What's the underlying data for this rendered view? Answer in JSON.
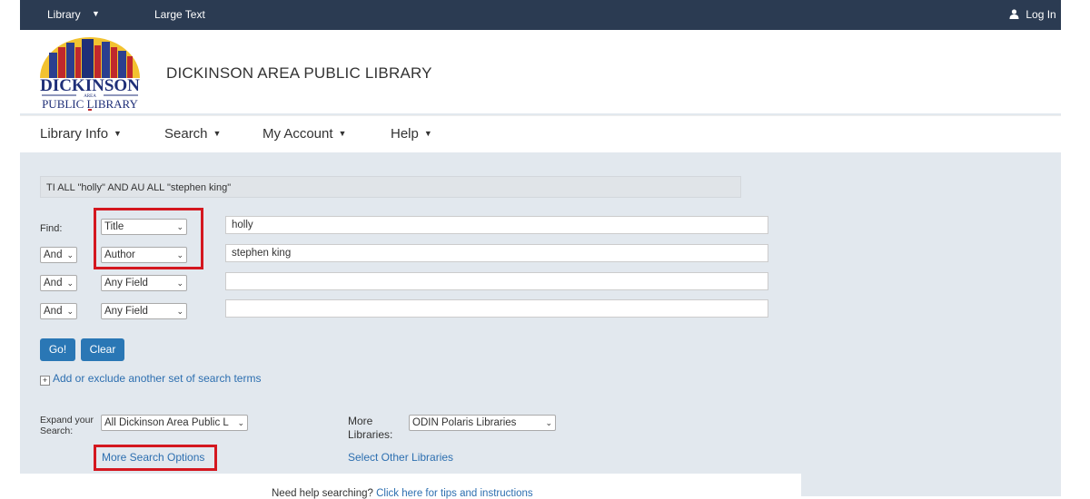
{
  "topbar": {
    "library_menu": "Library",
    "large_text": "Large Text",
    "login": "Log In"
  },
  "header": {
    "logo_text_top": "DICKINSON",
    "logo_text_mid": "AREA",
    "logo_text_bottom": "PUBLIC LIBRARY",
    "library_name": "DICKINSON AREA PUBLIC LIBRARY"
  },
  "nav": {
    "items": [
      "Library Info",
      "Search",
      "My Account",
      "Help"
    ]
  },
  "search": {
    "query_summary": "TI ALL \"holly\" AND AU ALL \"stephen king\"",
    "find_label": "Find:",
    "rows": [
      {
        "field": "Title",
        "value": "holly"
      },
      {
        "operator": "And",
        "field": "Author",
        "value": "stephen king"
      },
      {
        "operator": "And",
        "field": "Any Field",
        "value": ""
      },
      {
        "operator": "And",
        "field": "Any Field",
        "value": ""
      }
    ],
    "go_label": "Go!",
    "clear_label": "Clear",
    "add_terms_link": "Add or exclude another set of search terms",
    "expand_label_line1": "Expand your",
    "expand_label_line2": "Search:",
    "expand_value": "All Dickinson Area Public L",
    "more_libraries_line1": "More",
    "more_libraries_line2": "Libraries:",
    "more_libraries_value": "ODIN Polaris Libraries",
    "more_search_options": "More Search Options",
    "select_other_libraries": "Select Other Libraries",
    "help_prefix": "Need help searching?",
    "help_link": "Click here for tips and instructions"
  },
  "colors": {
    "topbar": "#2b3b52",
    "page_bg": "#e2e8ee",
    "button": "#2a77b5",
    "link": "#2d6fb0",
    "highlight": "#d4171f"
  }
}
